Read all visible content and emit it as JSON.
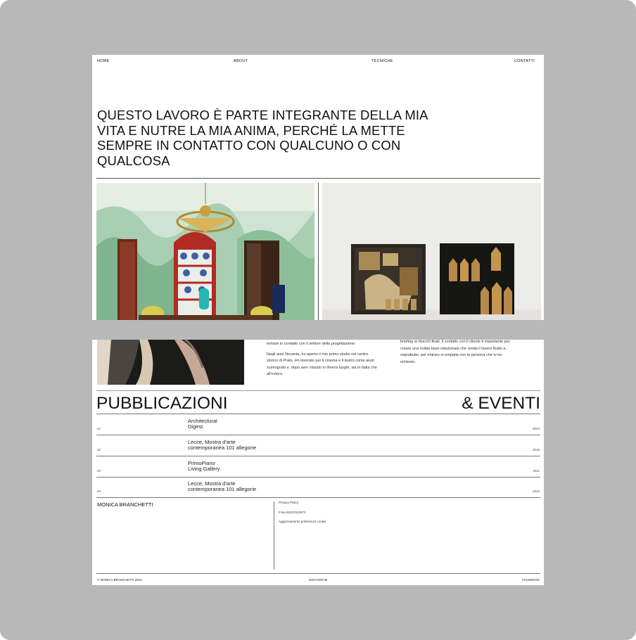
{
  "nav": {
    "home": "HOME",
    "about": "ABOUT",
    "techniques": "TECNICHE",
    "contacts": "CONTATTI"
  },
  "hero": {
    "title": "QUESTO LAVORO È PARTE INTEGRANTE DELLA MIA VITA E NUTRE LA MIA ANIMA, PERCHÉ LA METTE SEMPRE IN CONTATTO CON QUALCUNO O CON QUALCOSA"
  },
  "bio": {
    "col1_p1": "entrare in contatto con il settore della progettazione.",
    "col1_p2": "Negli anni Novanta, ho aperto il mio primo studio nel centro storico di Prato. Ho lavorato per il cinema e il teatro come aiuto scenografa e, dopo aver vissuto in diversi luoghi, sia in Italia che all'estero,",
    "col2_p1": "briefing ai ritocchi finali, il contatto con il cliente è importante per creare una solida base relazionale che renda il lavoro fluido e, soprattutto, per entrare in empatia con la persona che lo ha richiesto."
  },
  "publications": {
    "heading_left": "PUBBLICAZIONI",
    "heading_right": "& EVENTI",
    "rows": [
      {
        "num": "01",
        "title": "Architectural\nDigest",
        "year": "2023"
      },
      {
        "num": "02",
        "title": "Lecce, Mostra d'arte\ncontemporanea 101 allegorie",
        "year": "2016"
      },
      {
        "num": "03",
        "title": "PrimoPiano\nLiving Gallery",
        "year": "2011"
      },
      {
        "num": "04",
        "title": "Lecce, Mostra d'arte\ncontemporanea 101 allegorie",
        "year": "2016"
      }
    ]
  },
  "footer": {
    "name": "MONICA BRANCHETTI",
    "privacy": "Privacy Policy",
    "vat": "P.Iva 02337610972",
    "cookies": "Aggiornamento preferenze cookie",
    "copyright": "© MONICA BRANCHETTI 2023",
    "instagram": "INSTAGRAM",
    "facebook": "FACEBOOK"
  }
}
